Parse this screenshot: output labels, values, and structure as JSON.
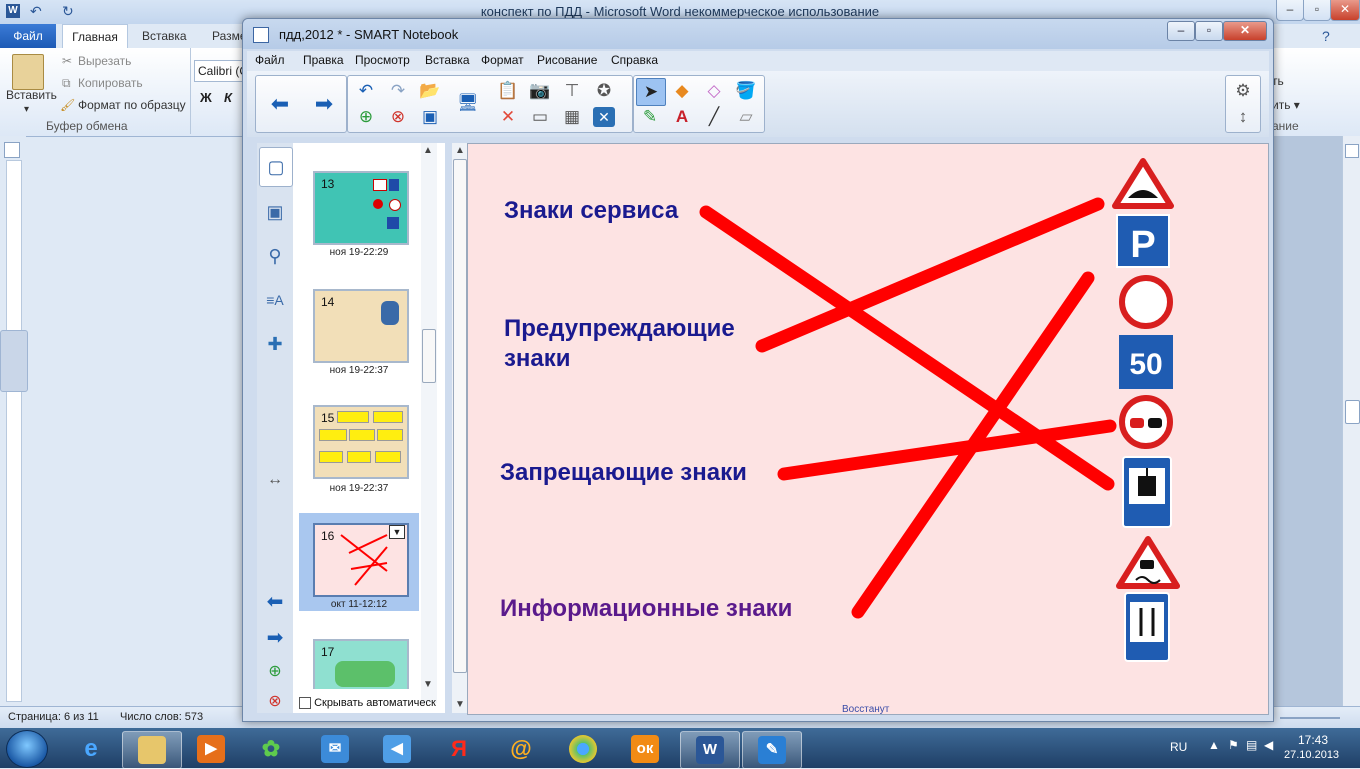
{
  "word": {
    "title": "конспект по ПДД  -  Microsoft Word некоммерческое использование",
    "tabs": [
      "Файл",
      "Главная",
      "Вставка",
      "Разме"
    ],
    "clipboard": {
      "paste": "Вставить",
      "cut": "Вырезать",
      "copy": "Копировать",
      "format_painter": "Формат по образцу",
      "group": "Буфер обмена"
    },
    "font_name": "Calibri (С",
    "bold": "Ж",
    "italic": "К",
    "status": {
      "page": "Страница: 6 из 11",
      "words": "Число слов: 573"
    },
    "right_fragments": [
      "ть",
      "ить ▾",
      "ание"
    ]
  },
  "smart": {
    "title": "пдд,2012 * - SMART Notebook",
    "menu": [
      "Файл",
      "Правка",
      "Просмотр",
      "Вставка",
      "Формат",
      "Рисование",
      "Справка"
    ],
    "hide_auto": "Скрывать автоматическ",
    "bottom_fragment": "Восстанут"
  },
  "slides": [
    {
      "num": "13",
      "caption": "ноя 19-22:29"
    },
    {
      "num": "14",
      "caption": "ноя 19-22:37"
    },
    {
      "num": "15",
      "caption": "ноя 19-22:37"
    },
    {
      "num": "16",
      "caption": "окт 11-12:12"
    },
    {
      "num": "17",
      "caption": ""
    }
  ],
  "page": {
    "labels": {
      "service": "Знаки сервиса",
      "warning_1": "Предупреждающие",
      "warning_2": "знаки",
      "prohibit": "Запрещающие знаки",
      "info": "Информационные знаки"
    },
    "sign_50": "50",
    "sign_parking": "P",
    "line_color": "#ff0000"
  },
  "taskbar": {
    "lang": "RU",
    "time": "17:43",
    "date": "27.10.2013"
  }
}
